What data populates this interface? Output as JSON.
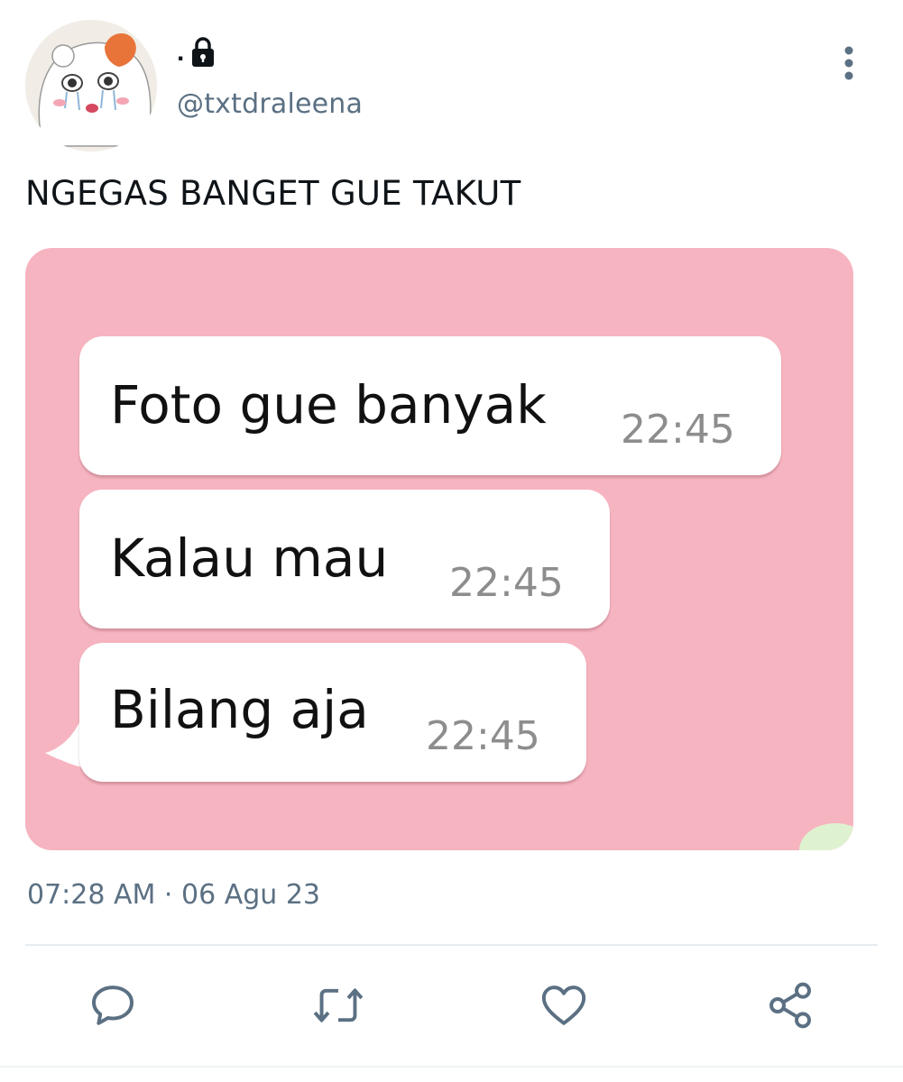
{
  "author": {
    "display_name": ".",
    "handle": "@txtdraleena",
    "avatar_icon": "crying-hamster-avatar",
    "protected_icon": "lock-icon"
  },
  "tweet": {
    "text": "NGEGAS BANGET GUE TAKUT",
    "timestamp": "07:28 AM · 06 Agu 23"
  },
  "media": {
    "background_color": "#f6b4c0",
    "messages": [
      {
        "text": "Foto gue banyak",
        "time": "22:45"
      },
      {
        "text": "Kalau mau",
        "time": "22:45"
      },
      {
        "text": "Bilang aja",
        "time": "22:45"
      }
    ]
  },
  "actions": {
    "reply_icon": "reply-icon",
    "retweet_icon": "retweet-icon",
    "like_icon": "heart-icon",
    "share_icon": "share-icon",
    "icon_color": "#5b7083"
  }
}
